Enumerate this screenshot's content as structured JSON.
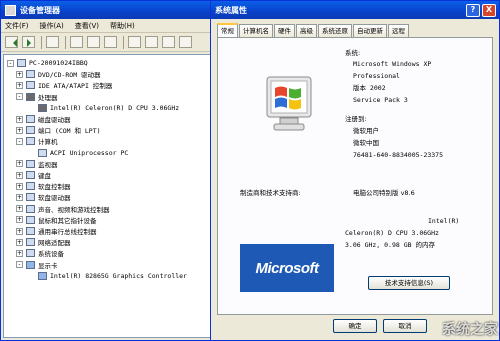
{
  "device_manager": {
    "title": "设备管理器",
    "menu": [
      "文件(F)",
      "操作(A)",
      "查看(V)",
      "帮助(H)"
    ],
    "tree": [
      {
        "label": "PC-20091024IBBQ",
        "level": 0,
        "expander": "-",
        "icon": "computer-icon"
      },
      {
        "label": "DVD/CD-ROM 驱动器",
        "level": 1,
        "expander": "+",
        "icon": "cdrom-icon"
      },
      {
        "label": "IDE ATA/ATAPI 控制器",
        "level": 1,
        "expander": "+",
        "icon": "ide-controller-icon"
      },
      {
        "label": "处理器",
        "level": 1,
        "expander": "-",
        "icon": "processor-icon"
      },
      {
        "label": "Intel(R) Celeron(R) D CPU 3.06GHz",
        "level": 2,
        "expander": "",
        "icon": "processor-icon"
      },
      {
        "label": "磁盘驱动器",
        "level": 1,
        "expander": "+",
        "icon": "disk-icon"
      },
      {
        "label": "端口 (COM 和 LPT)",
        "level": 1,
        "expander": "+",
        "icon": "port-icon"
      },
      {
        "label": "计算机",
        "level": 1,
        "expander": "-",
        "icon": "computer-icon"
      },
      {
        "label": "ACPI Uniprocessor PC",
        "level": 2,
        "expander": "",
        "icon": "computer-icon"
      },
      {
        "label": "监视器",
        "level": 1,
        "expander": "+",
        "icon": "monitor-icon"
      },
      {
        "label": "键盘",
        "level": 1,
        "expander": "+",
        "icon": "keyboard-icon"
      },
      {
        "label": "软盘控制器",
        "level": 1,
        "expander": "+",
        "icon": "floppy-controller-icon"
      },
      {
        "label": "软盘驱动器",
        "level": 1,
        "expander": "+",
        "icon": "floppy-icon"
      },
      {
        "label": "声音、视频和游戏控制器",
        "level": 1,
        "expander": "+",
        "icon": "sound-icon"
      },
      {
        "label": "鼠标和其它指针设备",
        "level": 1,
        "expander": "+",
        "icon": "mouse-icon"
      },
      {
        "label": "通用串行总线控制器",
        "level": 1,
        "expander": "+",
        "icon": "usb-icon"
      },
      {
        "label": "网络适配器",
        "level": 1,
        "expander": "+",
        "icon": "network-icon"
      },
      {
        "label": "系统设备",
        "level": 1,
        "expander": "+",
        "icon": "system-icon"
      },
      {
        "label": "显示卡",
        "level": 1,
        "expander": "-",
        "icon": "display-icon"
      },
      {
        "label": "Intel(R) 82865G Graphics Controller",
        "level": 2,
        "expander": "",
        "icon": "display-icon"
      }
    ]
  },
  "system_properties": {
    "title": "系统属性",
    "help_button": "?",
    "close_button": "X",
    "tabs": [
      "常规",
      "计算机名",
      "硬件",
      "高级",
      "系统还原",
      "自动更新",
      "远程"
    ],
    "system_label": "系统:",
    "system_lines": [
      "Microsoft Windows XP",
      "Professional",
      "版本 2002",
      "Service Pack 3"
    ],
    "registered_label": "注册到:",
    "registered_lines": [
      "微软用户",
      "微软中国",
      "76481-640-8834005-23375"
    ],
    "manufacturer_label": "制造商和技术支持商:",
    "manufacturer_value": "电脑公司特别版 v8.6",
    "cpu_lines": [
      "Intel(R)",
      "Celeron(R) D CPU 3.06GHz",
      "3.06 GHz, 0.98 GB 的内存"
    ],
    "logo_text": "Microsoft",
    "support_button": "技术支持信息(S)",
    "ok_button": "确定",
    "cancel_button": "取消"
  },
  "watermark": "系统之家"
}
